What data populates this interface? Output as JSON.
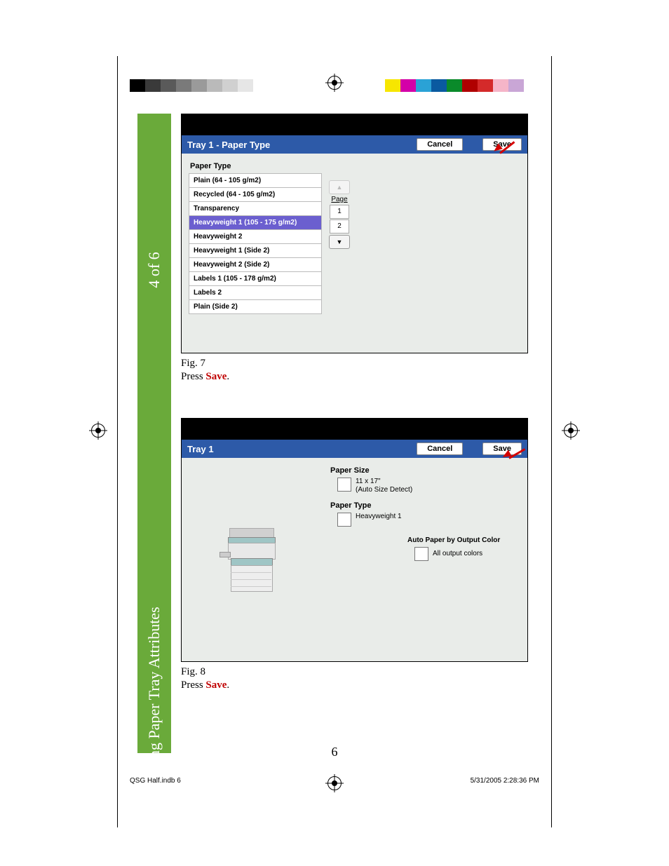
{
  "sidebar": {
    "step": "4 of 6",
    "title": "Changing Paper Tray Attributes"
  },
  "colors_left": [
    "#000000",
    "#3a3a3a",
    "#5a5a5a",
    "#7a7a7a",
    "#9a9a9a",
    "#bababa",
    "#d0d0d0",
    "#e6e6e6",
    "#ffffff"
  ],
  "colors_right": [
    "#f7e600",
    "#d400a8",
    "#2aa2d6",
    "#0a5aa0",
    "#0a8a2a",
    "#b00000",
    "#d42a2a",
    "#f5b5c8",
    "#c9a6d6",
    "#ffffff"
  ],
  "screen1": {
    "title": "Tray 1 - Paper Type",
    "cancel": "Cancel",
    "save": "Save",
    "paper_type_label": "Paper Type",
    "items": [
      "Plain (64 - 105 g/m2)",
      "Recycled (64 - 105 g/m2)",
      "Transparency",
      "Heavyweight 1 (105 - 175 g/m2)",
      "Heavyweight 2",
      "Heavyweight 1 (Side 2)",
      "Heavyweight 2 (Side 2)",
      "Labels 1 (105 - 178 g/m2)",
      "Labels 2",
      "Plain (Side 2)"
    ],
    "selected_index": 3,
    "pager": {
      "label": "Page",
      "p1": "1",
      "p2": "2"
    }
  },
  "fig1": {
    "caption": "Fig. 7",
    "press": "Press ",
    "kw": "Save",
    "end": "."
  },
  "screen2": {
    "title": "Tray 1",
    "cancel": "Cancel",
    "save": "Save",
    "paper_size_label": "Paper Size",
    "paper_size_value_l1": "11 x 17\"",
    "paper_size_value_l2": "(Auto Size Detect)",
    "paper_type_label": "Paper Type",
    "paper_type_value": "Heavyweight 1",
    "auto_label": "Auto Paper by Output Color",
    "auto_value": "All output colors"
  },
  "fig2": {
    "caption": "Fig. 8",
    "press": "Press ",
    "kw": "Save",
    "end": "."
  },
  "page_number": "6",
  "footer": {
    "left": "QSG Half.indb   6",
    "right": "5/31/2005   2:28:36 PM"
  }
}
